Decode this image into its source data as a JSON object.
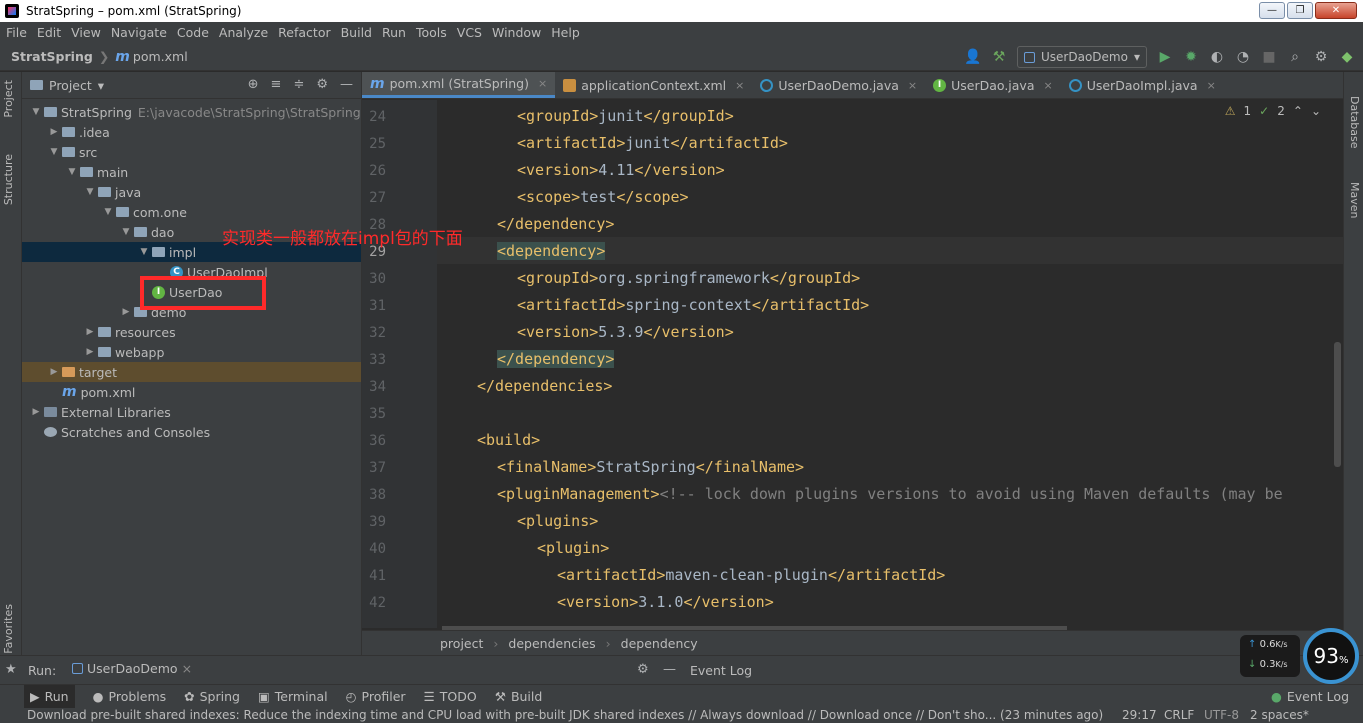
{
  "window": {
    "title": "StratSpring – pom.xml (StratSpring)"
  },
  "menu": [
    "File",
    "Edit",
    "View",
    "Navigate",
    "Code",
    "Analyze",
    "Refactor",
    "Build",
    "Run",
    "Tools",
    "VCS",
    "Window",
    "Help"
  ],
  "breadcrumb": {
    "project": "StratSpring",
    "file": "pom.xml"
  },
  "run_config": "UserDaoDemo",
  "left_tabs": {
    "project": "Project",
    "structure": "Structure",
    "favorites": "Favorites"
  },
  "right_tabs": {
    "database": "Database",
    "maven": "Maven"
  },
  "project_panel": {
    "title": "Project",
    "tree": [
      {
        "label": "StratSpring",
        "path": "E:\\javacode\\StratSpring\\StratSpring",
        "depth": 0,
        "icon": "folder"
      },
      {
        "label": ".idea",
        "depth": 1,
        "icon": "folder"
      },
      {
        "label": "src",
        "depth": 1,
        "icon": "folder"
      },
      {
        "label": "main",
        "depth": 2,
        "icon": "folder"
      },
      {
        "label": "java",
        "depth": 3,
        "icon": "folder"
      },
      {
        "label": "com.one",
        "depth": 4,
        "icon": "folder"
      },
      {
        "label": "dao",
        "depth": 5,
        "icon": "folder"
      },
      {
        "label": "impl",
        "depth": 6,
        "icon": "folder"
      },
      {
        "label": "UserDaoImpl",
        "depth": 7,
        "icon": "class"
      },
      {
        "label": "UserDao",
        "depth": 6,
        "icon": "interface"
      },
      {
        "label": "demo",
        "depth": 5,
        "icon": "folder"
      },
      {
        "label": "resources",
        "depth": 3,
        "icon": "folder"
      },
      {
        "label": "webapp",
        "depth": 3,
        "icon": "folder"
      },
      {
        "label": "target",
        "depth": 1,
        "icon": "folder-orange"
      },
      {
        "label": "pom.xml",
        "depth": 1,
        "icon": "maven"
      },
      {
        "label": "External Libraries",
        "depth": 0,
        "icon": "libs"
      },
      {
        "label": "Scratches and Consoles",
        "depth": 0,
        "icon": "scratch"
      }
    ]
  },
  "annotation": "实现类一般都放在impl包的下面",
  "editor": {
    "tabs": [
      {
        "label": "pom.xml (StratSpring)",
        "type": "maven",
        "active": true
      },
      {
        "label": "applicationContext.xml",
        "type": "xml"
      },
      {
        "label": "UserDaoDemo.java",
        "type": "class"
      },
      {
        "label": "UserDao.java",
        "type": "interface"
      },
      {
        "label": "UserDaoImpl.java",
        "type": "class"
      }
    ],
    "warnings": "1",
    "checks": "2",
    "lines": [
      {
        "n": "24",
        "indent": 3,
        "tokens": [
          [
            "tg",
            "<groupId>"
          ],
          [
            "t",
            "junit"
          ],
          [
            "tg",
            "</groupId>"
          ]
        ]
      },
      {
        "n": "25",
        "indent": 3,
        "tokens": [
          [
            "tg",
            "<artifactId>"
          ],
          [
            "t",
            "junit"
          ],
          [
            "tg",
            "</artifactId>"
          ]
        ]
      },
      {
        "n": "26",
        "indent": 3,
        "tokens": [
          [
            "tg",
            "<version>"
          ],
          [
            "t",
            "4.11"
          ],
          [
            "tg",
            "</version>"
          ]
        ]
      },
      {
        "n": "27",
        "indent": 3,
        "tokens": [
          [
            "tg",
            "<scope>"
          ],
          [
            "t",
            "test"
          ],
          [
            "tg",
            "</scope>"
          ]
        ]
      },
      {
        "n": "28",
        "indent": 2,
        "tokens": [
          [
            "tg",
            "</dependency>"
          ]
        ]
      },
      {
        "n": "29",
        "indent": 2,
        "tokens": [
          [
            "tgh",
            "<dependency>"
          ]
        ],
        "current": true
      },
      {
        "n": "30",
        "indent": 3,
        "tokens": [
          [
            "tg",
            "<groupId>"
          ],
          [
            "t",
            "org.springframework"
          ],
          [
            "tg",
            "</groupId>"
          ]
        ]
      },
      {
        "n": "31",
        "indent": 3,
        "tokens": [
          [
            "tg",
            "<artifactId>"
          ],
          [
            "t",
            "spring-context"
          ],
          [
            "tg",
            "</artifactId>"
          ]
        ]
      },
      {
        "n": "32",
        "indent": 3,
        "tokens": [
          [
            "tg",
            "<version>"
          ],
          [
            "t",
            "5.3.9"
          ],
          [
            "tg",
            "</version>"
          ]
        ]
      },
      {
        "n": "33",
        "indent": 2,
        "tokens": [
          [
            "tgh",
            "</dependency>"
          ]
        ]
      },
      {
        "n": "34",
        "indent": 1,
        "tokens": [
          [
            "tg",
            "</dependencies>"
          ]
        ]
      },
      {
        "n": "35",
        "indent": 0,
        "tokens": []
      },
      {
        "n": "36",
        "indent": 1,
        "tokens": [
          [
            "tg",
            "<build>"
          ]
        ]
      },
      {
        "n": "37",
        "indent": 2,
        "tokens": [
          [
            "tg",
            "<finalName>"
          ],
          [
            "t",
            "StratSpring"
          ],
          [
            "tg",
            "</finalName>"
          ]
        ]
      },
      {
        "n": "38",
        "indent": 2,
        "tokens": [
          [
            "tg",
            "<pluginManagement>"
          ],
          [
            "cm",
            "<!-- lock down plugins versions to avoid using Maven defaults (may be"
          ]
        ]
      },
      {
        "n": "39",
        "indent": 3,
        "tokens": [
          [
            "tg",
            "<plugins>"
          ]
        ]
      },
      {
        "n": "40",
        "indent": 4,
        "tokens": [
          [
            "tg",
            "<plugin>"
          ]
        ]
      },
      {
        "n": "41",
        "indent": 5,
        "tokens": [
          [
            "tg",
            "<artifactId>"
          ],
          [
            "t",
            "maven-clean-plugin"
          ],
          [
            "tg",
            "</artifactId>"
          ]
        ]
      },
      {
        "n": "42",
        "indent": 5,
        "tokens": [
          [
            "tg",
            "<version>"
          ],
          [
            "t",
            "3.1.0"
          ],
          [
            "tg",
            "</version>"
          ]
        ]
      }
    ],
    "breadcrumb": [
      "project",
      "dependencies",
      "dependency"
    ]
  },
  "bottom": {
    "run_label": "Run:",
    "run_tab": "UserDaoDemo",
    "event_log": "Event Log"
  },
  "tool_tabs": [
    "Run",
    "Problems",
    "Spring",
    "Terminal",
    "Profiler",
    "TODO",
    "Build"
  ],
  "event_log_tab": "Event Log",
  "status": {
    "message": "Download pre-built shared indexes: Reduce the indexing time and CPU load with pre-built JDK shared indexes // Always download // Download once // Don't sho... (23 minutes ago)",
    "position": "29:17",
    "line_sep": "CRLF",
    "encoding": "UTF-8",
    "indent": "2 spaces*"
  },
  "net": {
    "up": "0.6",
    "down": "0.3",
    "unit": "K/s"
  },
  "gauge": {
    "value": "93",
    "unit": "%"
  },
  "colors": {
    "tag": "#e8bf6a",
    "text": "#a9b7c6",
    "comment": "#808080",
    "annotation": "#ff2a2a",
    "selection": "#0d293e"
  }
}
